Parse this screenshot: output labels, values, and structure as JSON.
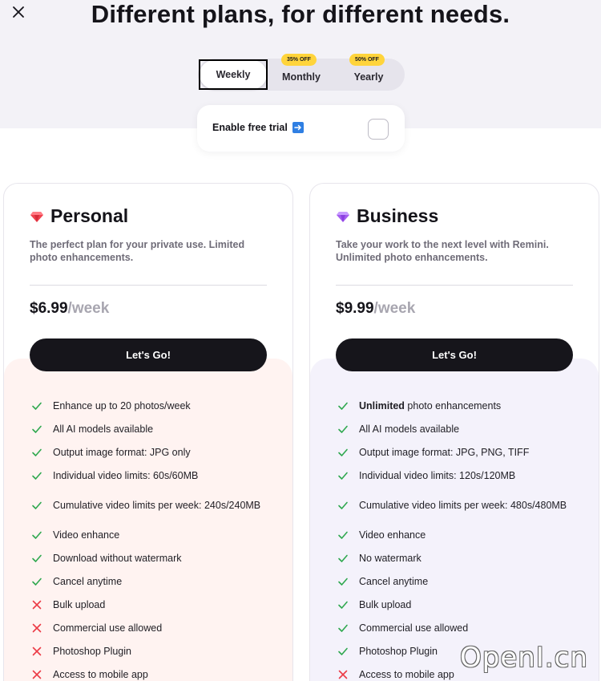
{
  "header": {
    "title": "Different plans, for different needs."
  },
  "billing_toggle": {
    "options": [
      {
        "label": "Weekly",
        "badge": ""
      },
      {
        "label": "Monthly",
        "badge": "35% OFF"
      },
      {
        "label": "Yearly",
        "badge": "50% OFF"
      }
    ],
    "selected": "Weekly"
  },
  "free_trial": {
    "label": "Enable free trial",
    "checked": false
  },
  "plans": [
    {
      "name": "Personal",
      "gem_color": "#f0414e",
      "description": "The perfect plan for your private use. Limited photo enhancements.",
      "price": "$6.99",
      "period": "/week",
      "cta": "Let's Go!",
      "features": [
        {
          "bold": "",
          "text": "Enhance up to 20 photos/week",
          "included": true
        },
        {
          "bold": "",
          "text": "All AI models available",
          "included": true
        },
        {
          "bold": "",
          "text": "Output image format: JPG only",
          "included": true
        },
        {
          "bold": "",
          "text": "Individual video limits: 60s/60MB",
          "included": true
        },
        {
          "bold": "",
          "text": "Cumulative video limits per week: 240s/240MB",
          "included": true
        },
        {
          "bold": "",
          "text": "Video enhance",
          "included": true
        },
        {
          "bold": "",
          "text": "Download without watermark",
          "included": true
        },
        {
          "bold": "",
          "text": "Cancel anytime",
          "included": true
        },
        {
          "bold": "",
          "text": "Bulk upload",
          "included": false
        },
        {
          "bold": "",
          "text": "Commercial use allowed",
          "included": false
        },
        {
          "bold": "",
          "text": "Photoshop Plugin",
          "included": false
        },
        {
          "bold": "",
          "text": "Access to mobile app",
          "included": false
        }
      ]
    },
    {
      "name": "Business",
      "gem_color": "#a45cf0",
      "description": "Take your work to the next level with Remini. Unlimited photo enhancements.",
      "price": "$9.99",
      "period": "/week",
      "cta": "Let's Go!",
      "features": [
        {
          "bold": "Unlimited",
          "text": " photo enhancements",
          "included": true
        },
        {
          "bold": "",
          "text": "All AI models available",
          "included": true
        },
        {
          "bold": "",
          "text": "Output image format: JPG, PNG, TIFF",
          "included": true
        },
        {
          "bold": "",
          "text": "Individual video limits: 120s/120MB",
          "included": true
        },
        {
          "bold": "",
          "text": "Cumulative video limits per week: 480s/480MB",
          "included": true
        },
        {
          "bold": "",
          "text": "Video enhance",
          "included": true
        },
        {
          "bold": "",
          "text": "No watermark",
          "included": true
        },
        {
          "bold": "",
          "text": "Cancel anytime",
          "included": true
        },
        {
          "bold": "",
          "text": "Bulk upload",
          "included": true
        },
        {
          "bold": "",
          "text": "Commercial use allowed",
          "included": true
        },
        {
          "bold": "",
          "text": "Photoshop Plugin",
          "included": true
        },
        {
          "bold": "",
          "text": "Access to mobile app",
          "included": false
        }
      ]
    }
  ],
  "colors": {
    "check": "#2fa84f",
    "cross": "#ec3b46",
    "accent_dark": "#16151b",
    "badge": "#ffd43b"
  },
  "watermark": "OpenI.cn"
}
